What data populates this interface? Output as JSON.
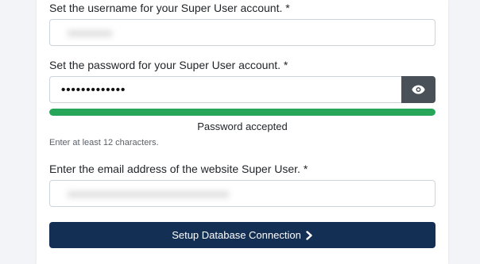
{
  "form": {
    "username": {
      "label": "Set the username for your Super User account. *",
      "value": "xxxxxxxx"
    },
    "password": {
      "label": "Set the password for your Super User account. *",
      "value": "•••••••••••••",
      "toggle_icon": "eye-icon",
      "strength_fraction": 1.0,
      "strength_color": "#27a65a",
      "strength_text": "Password accepted",
      "hint": "Enter at least 12 characters."
    },
    "email": {
      "label": "Enter the email address of the website Super User. *",
      "value": "xxxxxxxxxxxxxxxxxxxxxxxxxxxxx"
    },
    "submit": {
      "label": "Setup Database Connection",
      "icon": "chevron-right-icon",
      "color": "#132f53"
    }
  }
}
